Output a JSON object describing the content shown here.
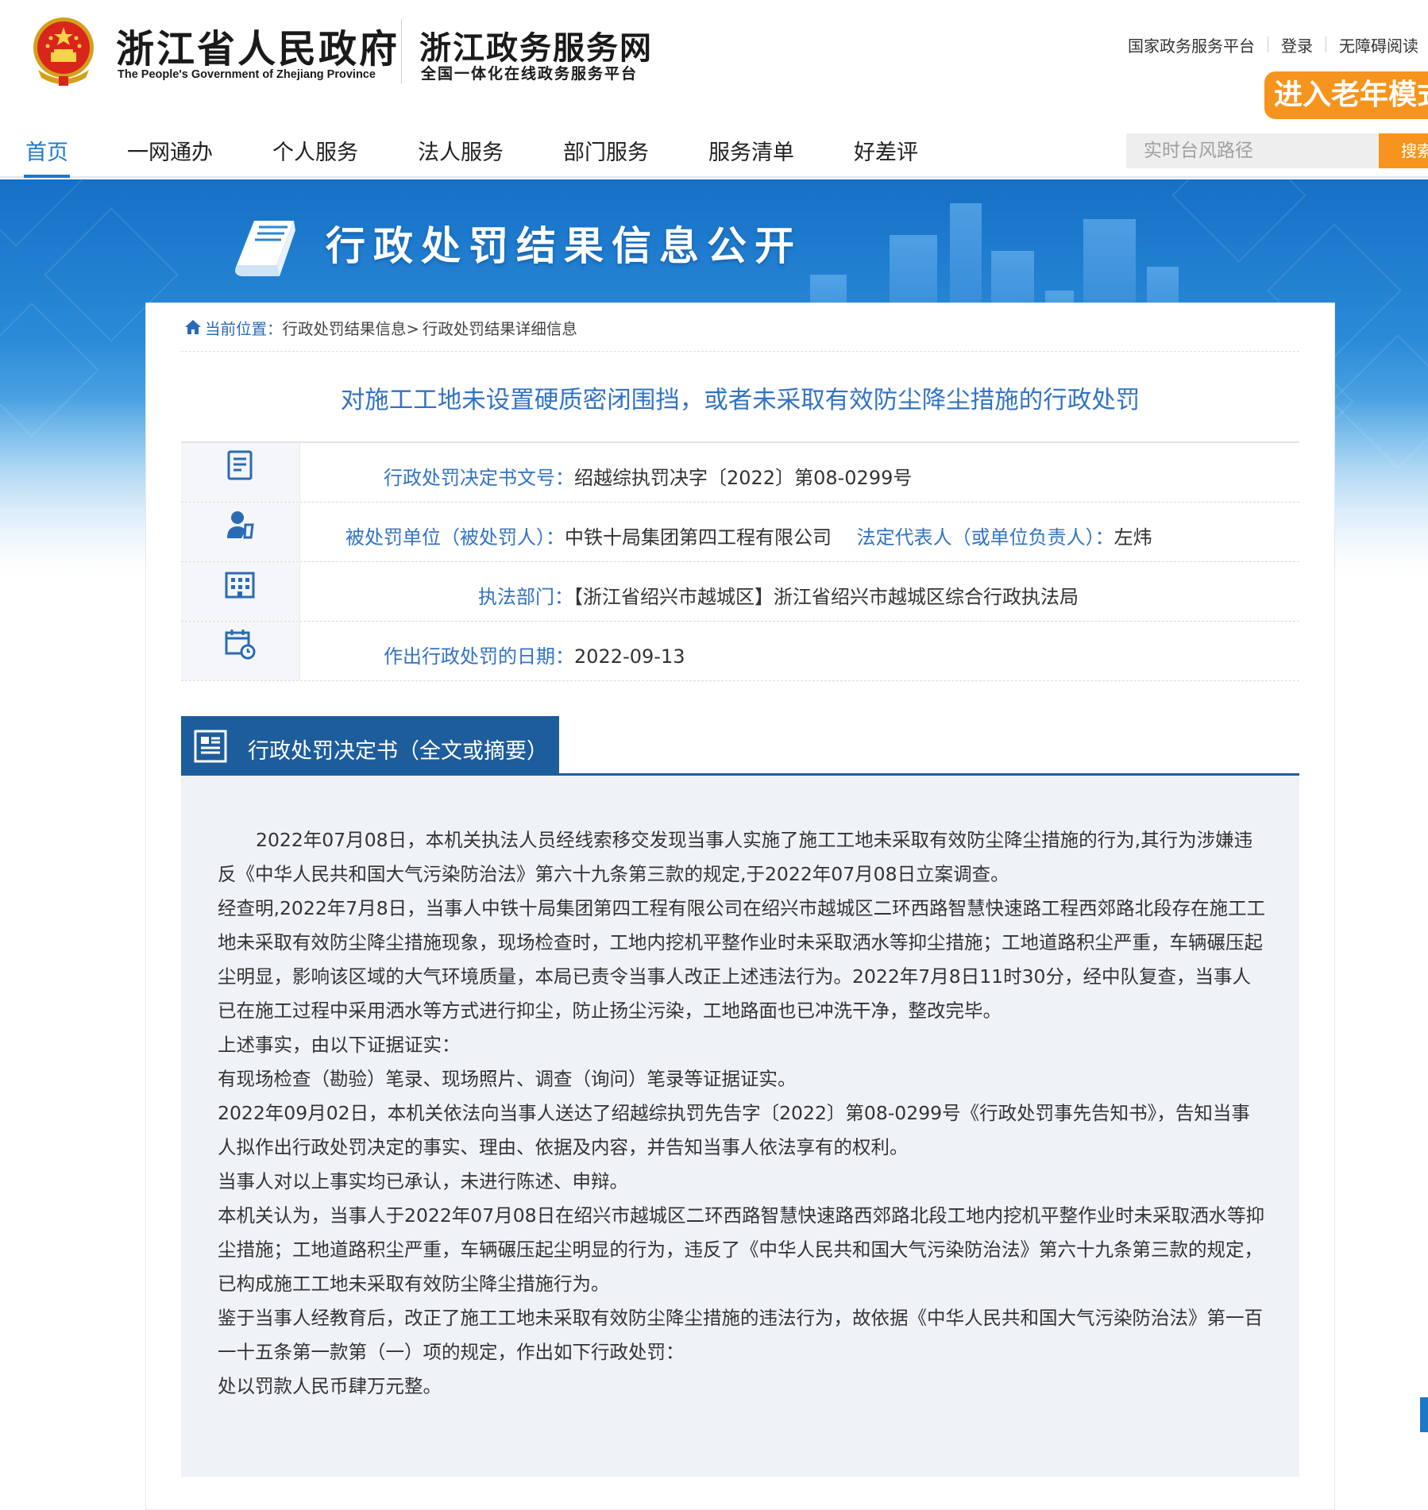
{
  "header": {
    "gov_title": "浙江省人民政府",
    "gov_subtitle": "The People's Government of Zhejiang Province",
    "portal_title": "浙江政务服务网",
    "portal_subtitle": "全国一体化在线政务服务平台",
    "top_links": [
      "国家政务服务平台",
      "登录",
      "无障碍阅读"
    ],
    "elder_mode": "进入老年模式",
    "emblem_icon": "national-emblem-icon"
  },
  "nav": {
    "items": [
      "首页",
      "一网通办",
      "个人服务",
      "法人服务",
      "部门服务",
      "服务清单",
      "好差评"
    ],
    "active_index": 0,
    "search_placeholder": "实时台风路径",
    "search_button": "搜索"
  },
  "banner": {
    "title": "行政处罚结果信息公开",
    "icon": "book-icon"
  },
  "breadcrumb": {
    "current_label": "当前位置：",
    "path": [
      "行政处罚结果信息>",
      "行政处罚结果详细信息"
    ]
  },
  "page_title": "对施工工地未设置硬质密闭围挡，或者未采取有效防尘降尘措施的行政处罚",
  "info": {
    "decision_no_label": "行政处罚决定书文号：",
    "decision_no": "绍越综执罚决字〔2022〕第08-0299号",
    "party_label": "被处罚单位（被处罚人）：",
    "party": "中铁十局集团第四工程有限公司",
    "rep_label": "法定代表人（或单位负责人）：",
    "rep": "左炜",
    "dept_label": "执法部门：",
    "dept": "【浙江省绍兴市越城区】浙江省绍兴市越城区综合行政执法局",
    "date_label": "作出行政处罚的日期：",
    "date": "2022-09-13"
  },
  "section": {
    "title": "行政处罚决定书（全文或摘要）"
  },
  "doc": {
    "p1": "2022年07月08日，本机关执法人员经线索移交发现当事人实施了施工工地未采取有效防尘降尘措施的行为,其行为涉嫌违反《中华人民共和国大气污染防治法》第六十九条第三款的规定,于2022年07月08日立案调查。",
    "p2": "经查明,2022年7月8日，当事人中铁十局集团第四工程有限公司在绍兴市越城区二环西路智慧快速路工程西郊路北段存在施工工地未采取有效防尘降尘措施现象，现场检查时，工地内挖机平整作业时未采取洒水等抑尘措施；工地道路积尘严重，车辆碾压起尘明显，影响该区域的大气环境质量，本局已责令当事人改正上述违法行为。2022年7月8日11时30分，经中队复查，当事人已在施工过程中采用洒水等方式进行抑尘，防止扬尘污染，工地路面也已冲洗干净，整改完毕。",
    "p3": "上述事实，由以下证据证实：",
    "p4": "有现场检查（勘验）笔录、现场照片、调查（询问）笔录等证据证实。",
    "p5": "2022年09月02日，本机关依法向当事人送达了绍越综执罚先告字〔2022〕第08-0299号《行政处罚事先告知书》，告知当事人拟作出行政处罚决定的事实、理由、依据及内容，并告知当事人依法享有的权利。",
    "p6": "当事人对以上事实均已承认，未进行陈述、申辩。",
    "p7": "本机关认为，当事人于2022年07月08日在绍兴市越城区二环西路智慧快速路西郊路北段工地内挖机平整作业时未采取洒水等抑尘措施；工地道路积尘严重，车辆碾压起尘明显的行为，违反了《中华人民共和国大气污染防治法》第六十九条第三款的规定，已构成施工工地未采取有效防尘降尘措施行为。",
    "p8": "鉴于当事人经教育后，改正了施工工地未采取有效防尘降尘措施的违法行为，故依据《中华人民共和国大气污染防治法》第一百一十五条第一款第（一）项的规定，作出如下行政处罚：",
    "p9": "处以罚款人民币肆万元整。"
  },
  "colors": {
    "accent_blue": "#1e78c8",
    "title_blue": "#3373c4",
    "section_blue": "#1e5d9c",
    "orange": "#f7941d"
  }
}
